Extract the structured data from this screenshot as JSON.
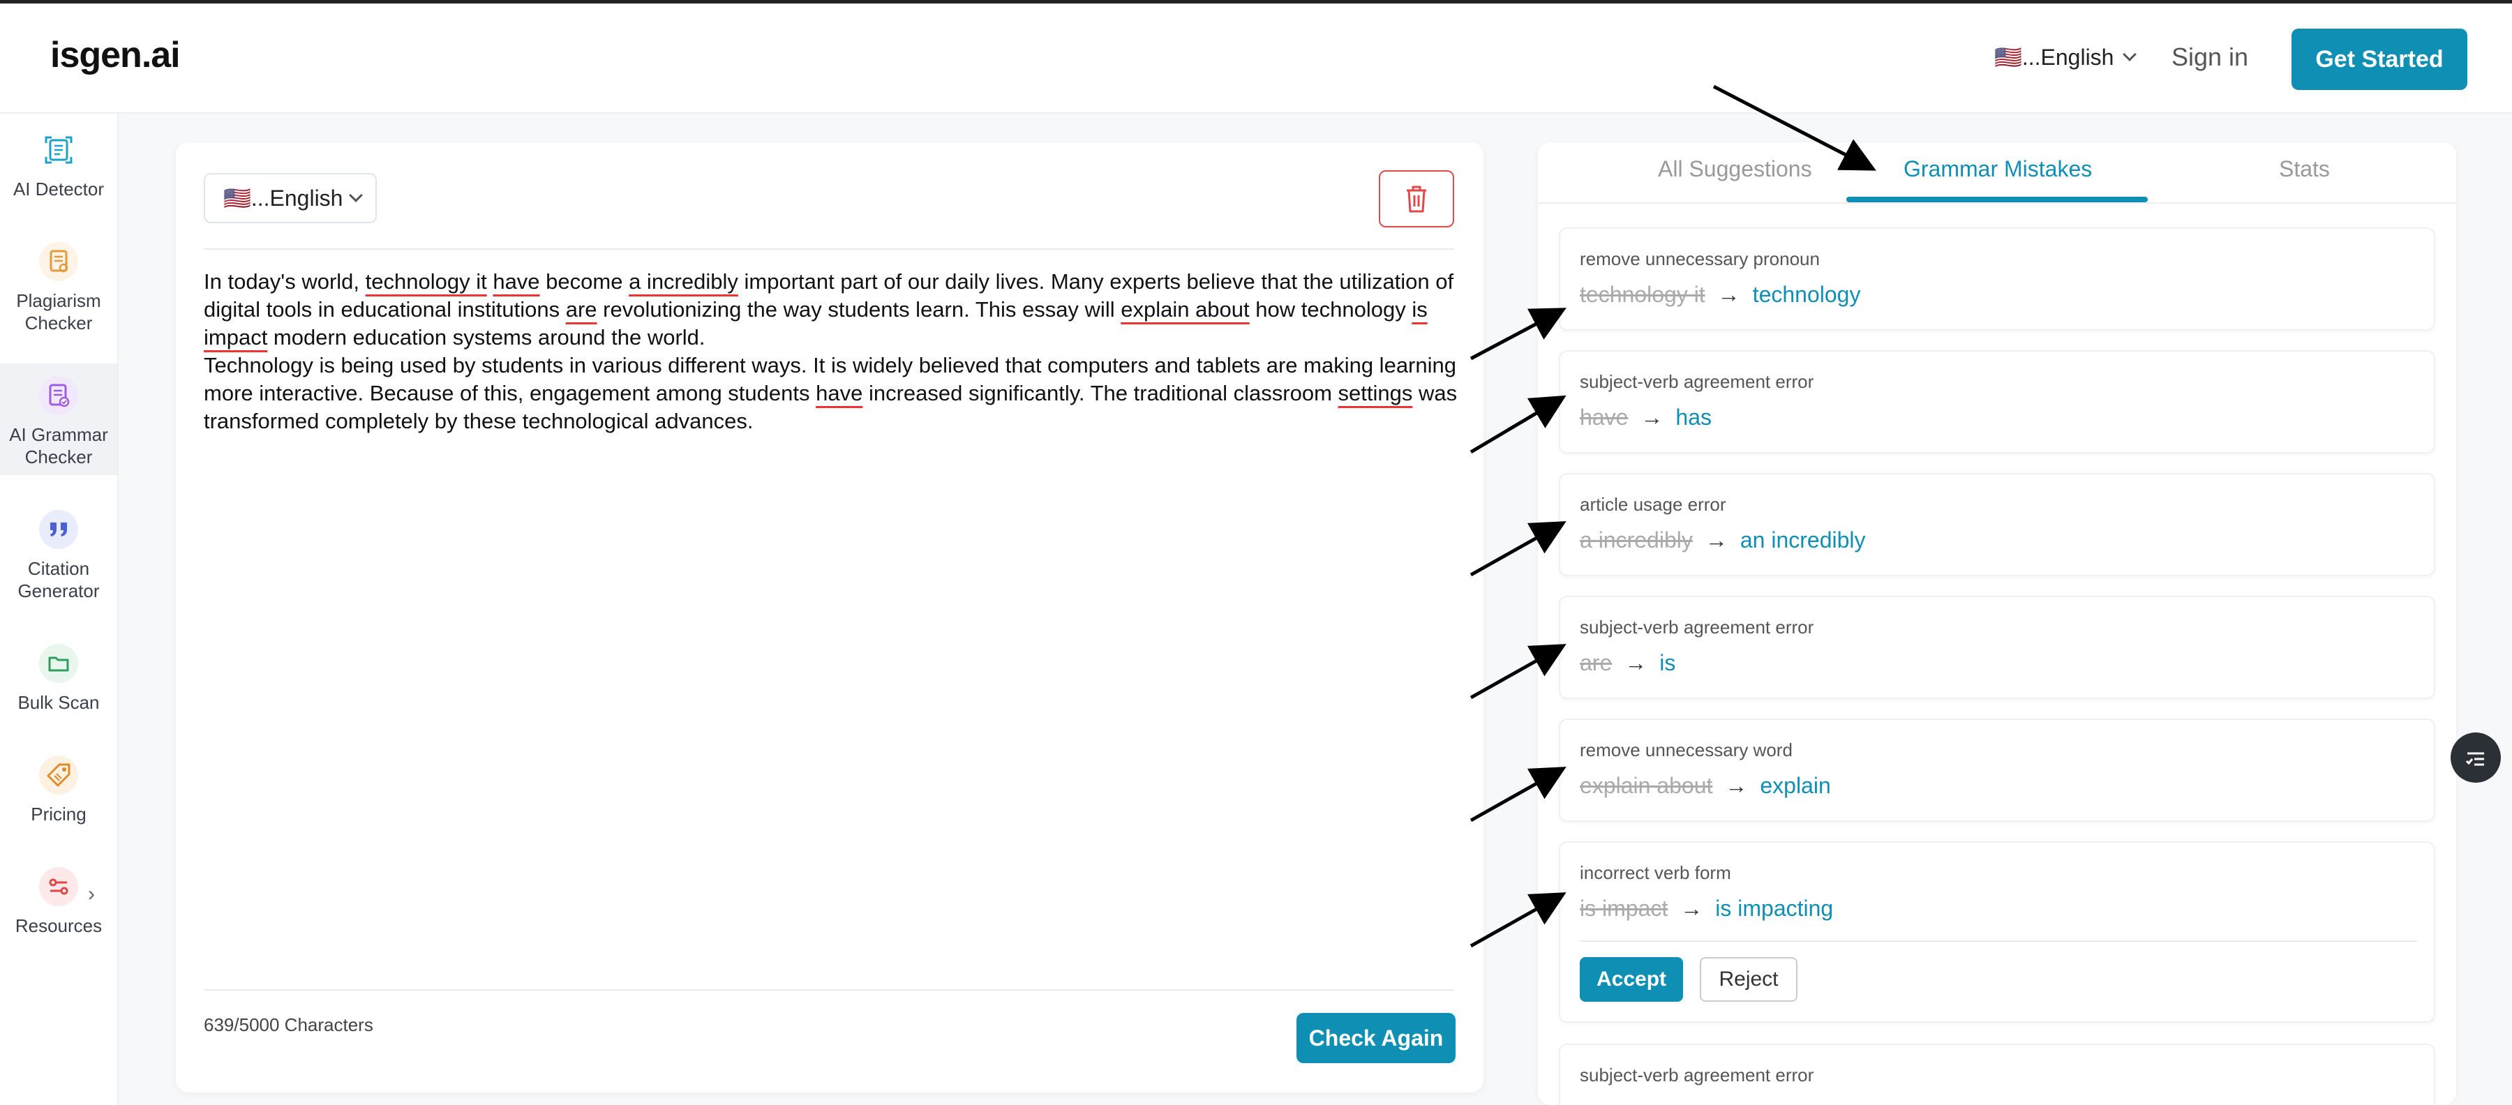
{
  "header": {
    "logo": "isgen.ai",
    "language": "🇺🇸...English",
    "sign_in": "Sign in",
    "get_started": "Get Started"
  },
  "sidebar": {
    "items": [
      {
        "label": "AI Detector",
        "icon": "ai-detector-icon",
        "color": "#1aa3c9"
      },
      {
        "label": "Plagiarism Checker",
        "icon": "plagiarism-icon",
        "color": "#e59a3a"
      },
      {
        "label": "AI Grammar Checker",
        "icon": "grammar-icon",
        "color": "#9b5de5"
      },
      {
        "label": "Citation Generator",
        "icon": "quote-icon",
        "color": "#4b5fd6"
      },
      {
        "label": "Bulk Scan",
        "icon": "folder-icon",
        "color": "#2f9e5c"
      },
      {
        "label": "Pricing",
        "icon": "tag-icon",
        "color": "#e08b2a"
      },
      {
        "label": "Resources",
        "icon": "resources-icon",
        "color": "#e04848"
      }
    ]
  },
  "editor": {
    "language": "🇺🇸...English",
    "text_segments": [
      {
        "t": "In today's world, "
      },
      {
        "t": "technology it",
        "err": true
      },
      {
        "t": " "
      },
      {
        "t": "have",
        "err": true
      },
      {
        "t": " become "
      },
      {
        "t": "a incredibly",
        "err": true
      },
      {
        "t": " important part of our daily lives. Many experts believe that the utilization of digital tools in educational institutions "
      },
      {
        "t": "are",
        "err": true
      },
      {
        "t": " revolutionizing the way students learn. This essay will "
      },
      {
        "t": "explain about",
        "err": true
      },
      {
        "t": " how technology "
      },
      {
        "t": "is impact",
        "err": true
      },
      {
        "t": " modern education systems around the world."
      },
      {
        "br": true
      },
      {
        "t": "Technology is being used by students in various different ways. It is widely believed that computers and tablets are making learning more interactive. Because of this, engagement among students "
      },
      {
        "t": "have",
        "err": true
      },
      {
        "t": " increased significantly. The traditional classroom "
      },
      {
        "t": "settings",
        "err": true
      },
      {
        "t": " was transformed completely by these technological advances."
      }
    ],
    "char_count": "639/5000 Characters",
    "check_again": "Check Again"
  },
  "panel": {
    "tabs": [
      "All Suggestions",
      "Grammar Mistakes",
      "Stats"
    ],
    "active_tab": 1,
    "cards": [
      {
        "title": "remove unnecessary pronoun",
        "old": "technology it",
        "new": "technology"
      },
      {
        "title": "subject-verb agreement error",
        "old": "have",
        "new": "has"
      },
      {
        "title": "article usage error",
        "old": "a incredibly",
        "new": "an incredibly"
      },
      {
        "title": "subject-verb agreement error",
        "old": "are",
        "new": "is"
      },
      {
        "title": "remove unnecessary word",
        "old": "explain about",
        "new": "explain"
      },
      {
        "title": "incorrect verb form",
        "old": "is impact",
        "new": "is impacting",
        "expanded": true
      },
      {
        "title": "subject-verb agreement error"
      }
    ],
    "accept": "Accept",
    "reject": "Reject"
  },
  "colors": {
    "accent": "#0f8fb4",
    "error": "#e33333"
  }
}
